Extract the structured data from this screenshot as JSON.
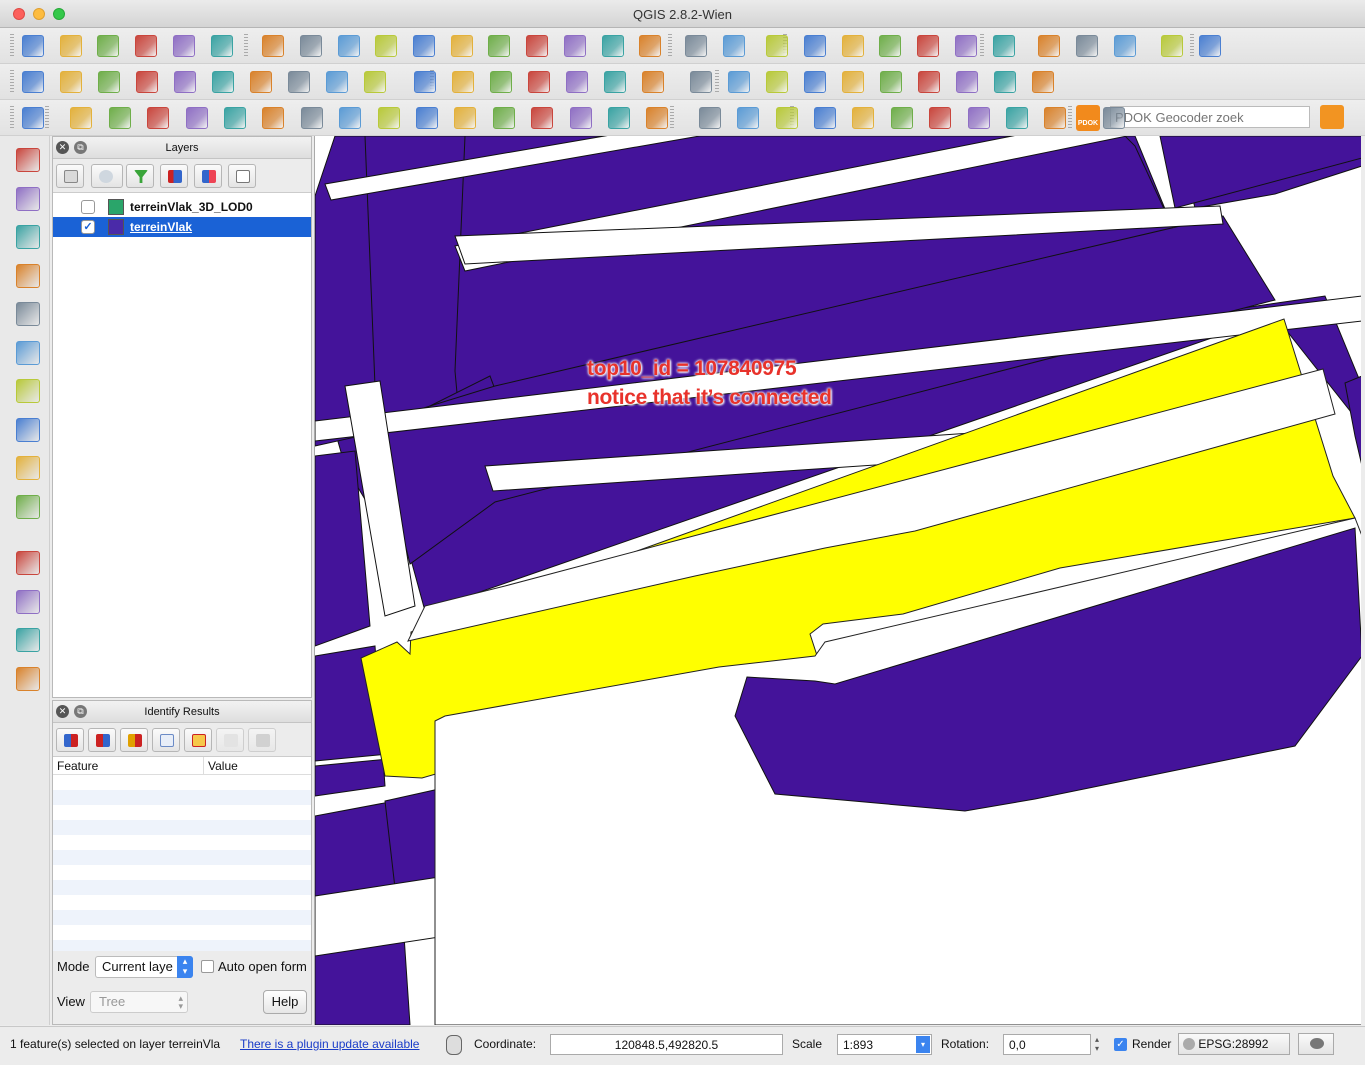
{
  "window": {
    "title": "QGIS 2.8.2-Wien"
  },
  "toolbar_row1_icons": [
    "new-project-icon",
    "open-project-icon",
    "save-project-icon",
    "save-as-icon",
    "new-print-composer-icon",
    "composer-manager-icon",
    "pan-icon",
    "pan-to-selection-icon",
    "zoom-in-icon",
    "zoom-out-icon",
    "zoom-native-icon",
    "zoom-full-icon",
    "zoom-to-selection-icon",
    "zoom-to-layer-icon",
    "zoom-last-icon",
    "zoom-next-icon",
    "refresh-icon",
    "identify-icon",
    "measure-icon",
    "select-features-icon",
    "deselect-icon",
    "expression-select-icon",
    "attribute-table-icon",
    "field-calculator-icon",
    "measure-line-icon",
    "map-tips-icon",
    "new-bookmark-icon",
    "show-bookmarks-icon",
    "text-annotation-icon",
    "help-icon",
    "whats-this-icon"
  ],
  "toolbar_row2_icons": [
    "current-edits-icon",
    "toggle-editing-icon",
    "save-edits-icon",
    "add-feature-icon",
    "move-feature-icon",
    "node-tool-icon",
    "delete-selected-icon",
    "cut-features-icon",
    "copy-features-icon",
    "paste-features-icon",
    "label-icon",
    "pin-label-icon",
    "highlight-label-icon",
    "move-label-icon",
    "rotate-label-icon",
    "change-label-icon",
    "more-tools-icon",
    "csw-icon",
    "plugin-icon",
    "python-console-icon",
    "percent-icon",
    "wkt-icon",
    "p-red-icon",
    "p-blue-icon",
    "wkt-paste-icon",
    "svg-icon",
    "identify-plus-icon"
  ],
  "toolbar_row3_icons": [
    "snapping-icon",
    "undo-icon",
    "redo-icon",
    "simplify-icon",
    "add-ring-icon",
    "add-part-icon",
    "fill-ring-icon",
    "delete-ring-icon",
    "delete-part-icon",
    "reshape-icon",
    "offset-curve-icon",
    "split-features-icon",
    "split-parts-icon",
    "merge-features-icon",
    "merge-attributes-icon",
    "rotate-point-icon",
    "rotate-icon",
    "layer-add-icon",
    "layer-new-icon",
    "layer-remove-icon",
    "digitize-icon",
    "add-vertex-icon",
    "move-vertex-icon",
    "edit-vertex-icon",
    "grid-icon",
    "select-icon",
    "deselect-icon",
    "pdok-icon"
  ],
  "toolbar_row3": {
    "search_placeholder": "PDOK Geocoder zoek",
    "pdok_label": "PDOK"
  },
  "left_toolbar_icons": [
    "add-vector-layer-icon",
    "add-raster-layer-icon",
    "add-postgis-layer-icon",
    "add-spatialite-layer-icon",
    "add-mssql-layer-icon",
    "add-wms-layer-icon",
    "add-wcs-layer-icon",
    "add-wfs-layer-icon",
    "add-delimited-text-icon",
    "new-shapefile-layer-icon",
    "georeferencer-icon",
    "add-wkt-icon",
    "text-annotation-icon",
    "processing-icon"
  ],
  "layers_panel": {
    "title": "Layers",
    "layers": [
      {
        "name": "terreinVlak_3D_LOD0",
        "checked": false,
        "selected": false,
        "swatch": "#2aa56a"
      },
      {
        "name": "terreinVlak",
        "checked": true,
        "selected": true,
        "swatch": "#4a2aa8"
      }
    ]
  },
  "identify_panel": {
    "title": "Identify Results",
    "col_feature": "Feature",
    "col_value": "Value",
    "mode_label": "Mode",
    "mode_value": "Current laye",
    "auto_open_label": "Auto open form",
    "view_label": "View",
    "view_value": "Tree",
    "help_label": "Help"
  },
  "map": {
    "fill_color": "#44139a",
    "selected_color": "#ffff00",
    "annotation_line1": "top10_id = 107840975",
    "annotation_line2": "notice that it’s connected"
  },
  "statusbar": {
    "message": "1 feature(s) selected on layer terreinVla",
    "plugin_link": "There is a plugin update available",
    "coordinate_label": "Coordinate:",
    "coordinate_value": "120848.5,492820.5",
    "scale_label": "Scale",
    "scale_value": "1:893",
    "rotation_label": "Rotation:",
    "rotation_value": "0,0",
    "render_label": "Render",
    "crs_label": "EPSG:28992"
  }
}
